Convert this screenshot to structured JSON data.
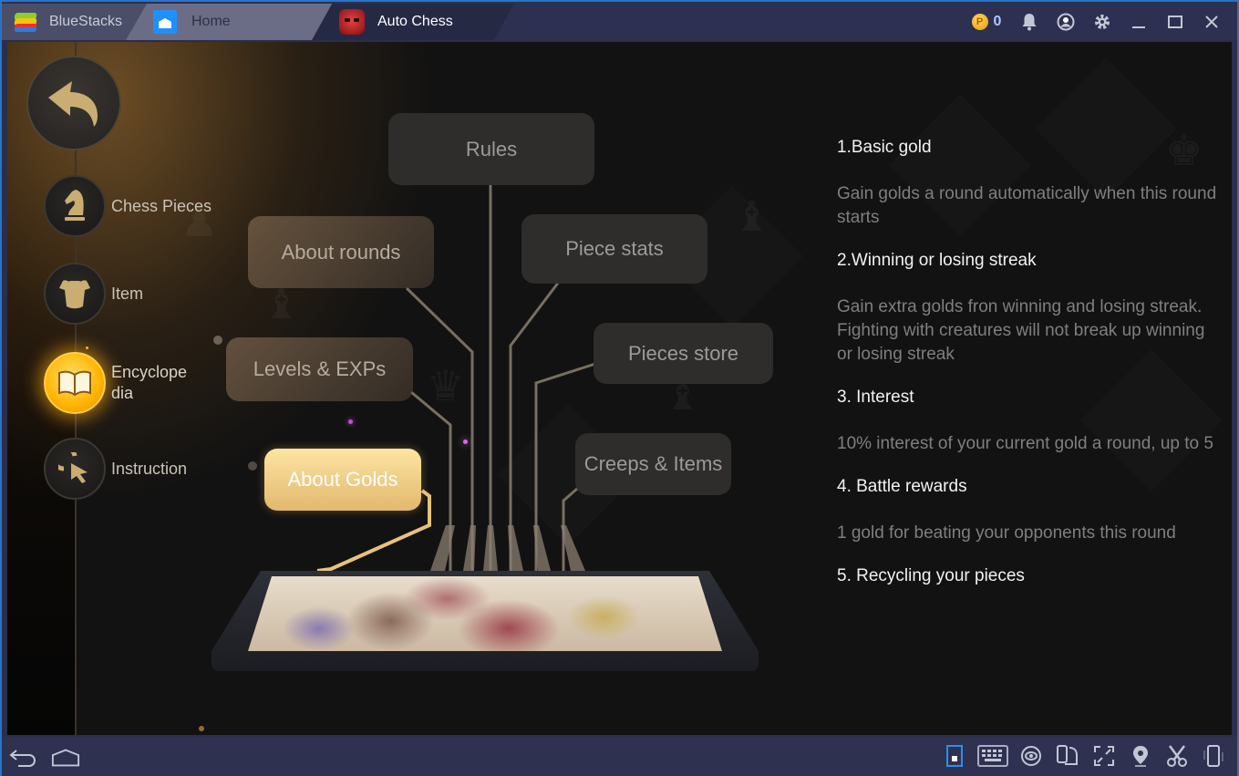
{
  "titlebar": {
    "app_name": "BlueStacks",
    "tabs": [
      {
        "label": "Home",
        "icon": "home-icon"
      },
      {
        "label": "Auto Chess",
        "icon": "auto-chess-app-icon",
        "active": true
      }
    ],
    "coin_symbol": "P",
    "coin_count": "0",
    "controls": [
      "coin-icon",
      "bell-icon",
      "account-icon",
      "gear-icon",
      "minimize-icon",
      "maximize-icon",
      "close-icon"
    ]
  },
  "sidebar": {
    "back_icon": "back-arrow-icon",
    "items": [
      {
        "label": "Chess Pieces",
        "icon": "knight-icon",
        "active": false
      },
      {
        "label": "Item",
        "icon": "armor-icon",
        "active": false
      },
      {
        "label": "Encyclope\ndia",
        "label_line1": "Encyclope",
        "label_line2": "dia",
        "icon": "book-icon",
        "active": true
      },
      {
        "label": "Instruction",
        "icon": "pointer-cursor-icon",
        "active": false
      }
    ]
  },
  "topics": [
    {
      "label": "Rules",
      "active": false
    },
    {
      "label": "About rounds",
      "active": false
    },
    {
      "label": "Piece stats",
      "active": false
    },
    {
      "label": "Levels & EXPs",
      "active": false
    },
    {
      "label": "Pieces store",
      "active": false
    },
    {
      "label": "About Golds",
      "active": true
    },
    {
      "label": "Creeps & Items",
      "active": false
    }
  ],
  "content": {
    "sections": [
      {
        "heading": "1.Basic gold",
        "body": "Gain golds a round automatically when this round starts"
      },
      {
        "heading": "2.Winning or losing streak",
        "body": "Gain extra golds fron winning and losing streak. Fighting with creatures will not break up winning or losing streak"
      },
      {
        "heading": "3. Interest",
        "body": "10% interest of your current gold a round, up to 5"
      },
      {
        "heading": "4. Battle rewards",
        "body": "1 gold for beating your opponents this round"
      },
      {
        "heading": "5. Recycling your pieces",
        "body": ""
      }
    ]
  },
  "bottombar": {
    "left": [
      "android-back-icon",
      "android-home-icon"
    ],
    "right": [
      "game-controls-icon",
      "keyboard-icon",
      "eye-icon",
      "rotate-screen-icon",
      "fullscreen-icon",
      "location-pin-icon",
      "scissors-icon",
      "shake-device-icon"
    ]
  },
  "colors": {
    "accent_gold": "#e2b86e",
    "active_nav": "#ffb400",
    "frame_blue": "#2a73c8",
    "heading_text": "#f2f2f2",
    "body_text": "#7f7f7f"
  }
}
